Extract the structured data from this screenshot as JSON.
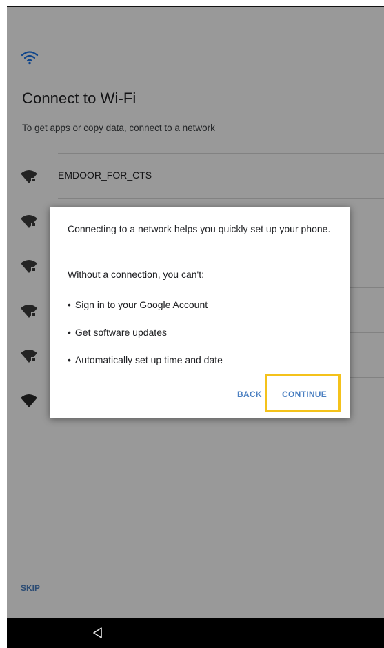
{
  "setup": {
    "title": "Connect to Wi-Fi",
    "subtitle": "To get apps or copy data, connect to a network",
    "networks": [
      {
        "ssid": "EMDOOR_FOR_CTS",
        "icon": "wifi-lock-icon"
      },
      {
        "ssid": "",
        "icon": "wifi-lock-icon"
      },
      {
        "ssid": "",
        "icon": "wifi-lock-icon"
      },
      {
        "ssid": "",
        "icon": "wifi-lock-icon"
      },
      {
        "ssid": "",
        "icon": "wifi-lock-icon"
      },
      {
        "ssid": "",
        "icon": "wifi-icon"
      }
    ],
    "skip_label": "SKIP"
  },
  "dialog": {
    "intro": "Connecting to a network helps you quickly set up your phone.",
    "without": "Without a connection, you can't:",
    "bullets": [
      "Sign in to your Google Account",
      "Get software updates",
      "Automatically set up time and date"
    ],
    "bullet_glyph": "•",
    "back_label": "BACK",
    "continue_label": "CONTINUE"
  },
  "colors": {
    "accent": "#4a7fc1",
    "highlight": "#f4c21b",
    "scrim": "rgba(0,0,0,0.40)"
  }
}
